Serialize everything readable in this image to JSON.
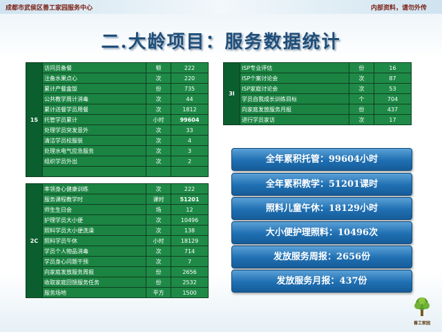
{
  "header": {
    "org": "成都市武侯区善工家园服务中心",
    "notice": "内部资料，请勿外传"
  },
  "title": "二.大龄项目：服务数据统计",
  "table_1s": {
    "category": "1S",
    "rows": [
      {
        "item": "访问员备餐",
        "unit": "顿",
        "value": "222"
      },
      {
        "item": "注备水果点心",
        "unit": "次",
        "value": "220"
      },
      {
        "item": "累计产餐盒饭",
        "unit": "份",
        "value": "735"
      },
      {
        "item": "公共教学周计消毒",
        "unit": "次",
        "value": "44"
      },
      {
        "item": "累计送餐学员用餐",
        "unit": "次",
        "value": "1812"
      },
      {
        "item": "托管学员累计",
        "unit": "小时",
        "value": "99604"
      },
      {
        "item": "处理学员突发意外",
        "unit": "次",
        "value": "33"
      },
      {
        "item": "清洁学员校服装",
        "unit": "次",
        "value": "4"
      },
      {
        "item": "处理水电气应急服务",
        "unit": "次",
        "value": "3"
      },
      {
        "item": "组织学员外出",
        "unit": "次",
        "value": "2"
      },
      {
        "item": "",
        "unit": "",
        "value": ""
      }
    ]
  },
  "table_2c": {
    "category": "2C",
    "rows": [
      {
        "item": "率领身心健康训练",
        "unit": "次",
        "value": "222"
      },
      {
        "item": "服务课程教学时",
        "unit": "课时",
        "value": "51201"
      },
      {
        "item": "师生生日会",
        "unit": "场",
        "value": "12"
      },
      {
        "item": "护理学员大小便",
        "unit": "次",
        "value": "10496"
      },
      {
        "item": "照料学员大小便洗澡",
        "unit": "次",
        "value": "138"
      },
      {
        "item": "照料学员午休",
        "unit": "小时",
        "value": "18129"
      },
      {
        "item": "学员个人物品消毒",
        "unit": "次",
        "value": "714"
      },
      {
        "item": "学员身心问题干预",
        "unit": "次",
        "value": "7"
      },
      {
        "item": "向家庭发放服务周报",
        "unit": "份",
        "value": "2656"
      },
      {
        "item": "收取家庭回馈服务任务",
        "unit": "份",
        "value": "2532"
      },
      {
        "item": "服务场地",
        "unit": "平方",
        "value": "1500"
      }
    ]
  },
  "table_3i": {
    "category": "3I",
    "rows": [
      {
        "item": "ISP专业评估",
        "unit": "份",
        "value": "16"
      },
      {
        "item": "ISP个案讨论会",
        "unit": "次",
        "value": "87"
      },
      {
        "item": "ISP家庭讨论会",
        "unit": "次",
        "value": "53"
      },
      {
        "item": "学员自我成长训练目标",
        "unit": "个",
        "value": "704"
      },
      {
        "item": "向家庭发放服务月报",
        "unit": "份",
        "value": "437"
      },
      {
        "item": "进行学员家访",
        "unit": "次",
        "value": "17"
      }
    ]
  },
  "summary": [
    "全年累积托管：99604小时",
    "全年累积教学：51201课时",
    "照料儿童午休：18129小时",
    "大小便护理照料：10496次",
    "发放服务周报：2656份",
    "发放服务月报：437份"
  ],
  "logo": {
    "name": "善工家园",
    "icon": "tree-icon",
    "colors": {
      "leaf": "#5a9a2a",
      "trunk": "#7a5a22"
    }
  },
  "colors": {
    "table_dark": "#0b5e2e",
    "table_cell": "#1f8a47",
    "highlight": "#ffee33",
    "button": "#1f6fb2",
    "title": "#1f4e79"
  }
}
